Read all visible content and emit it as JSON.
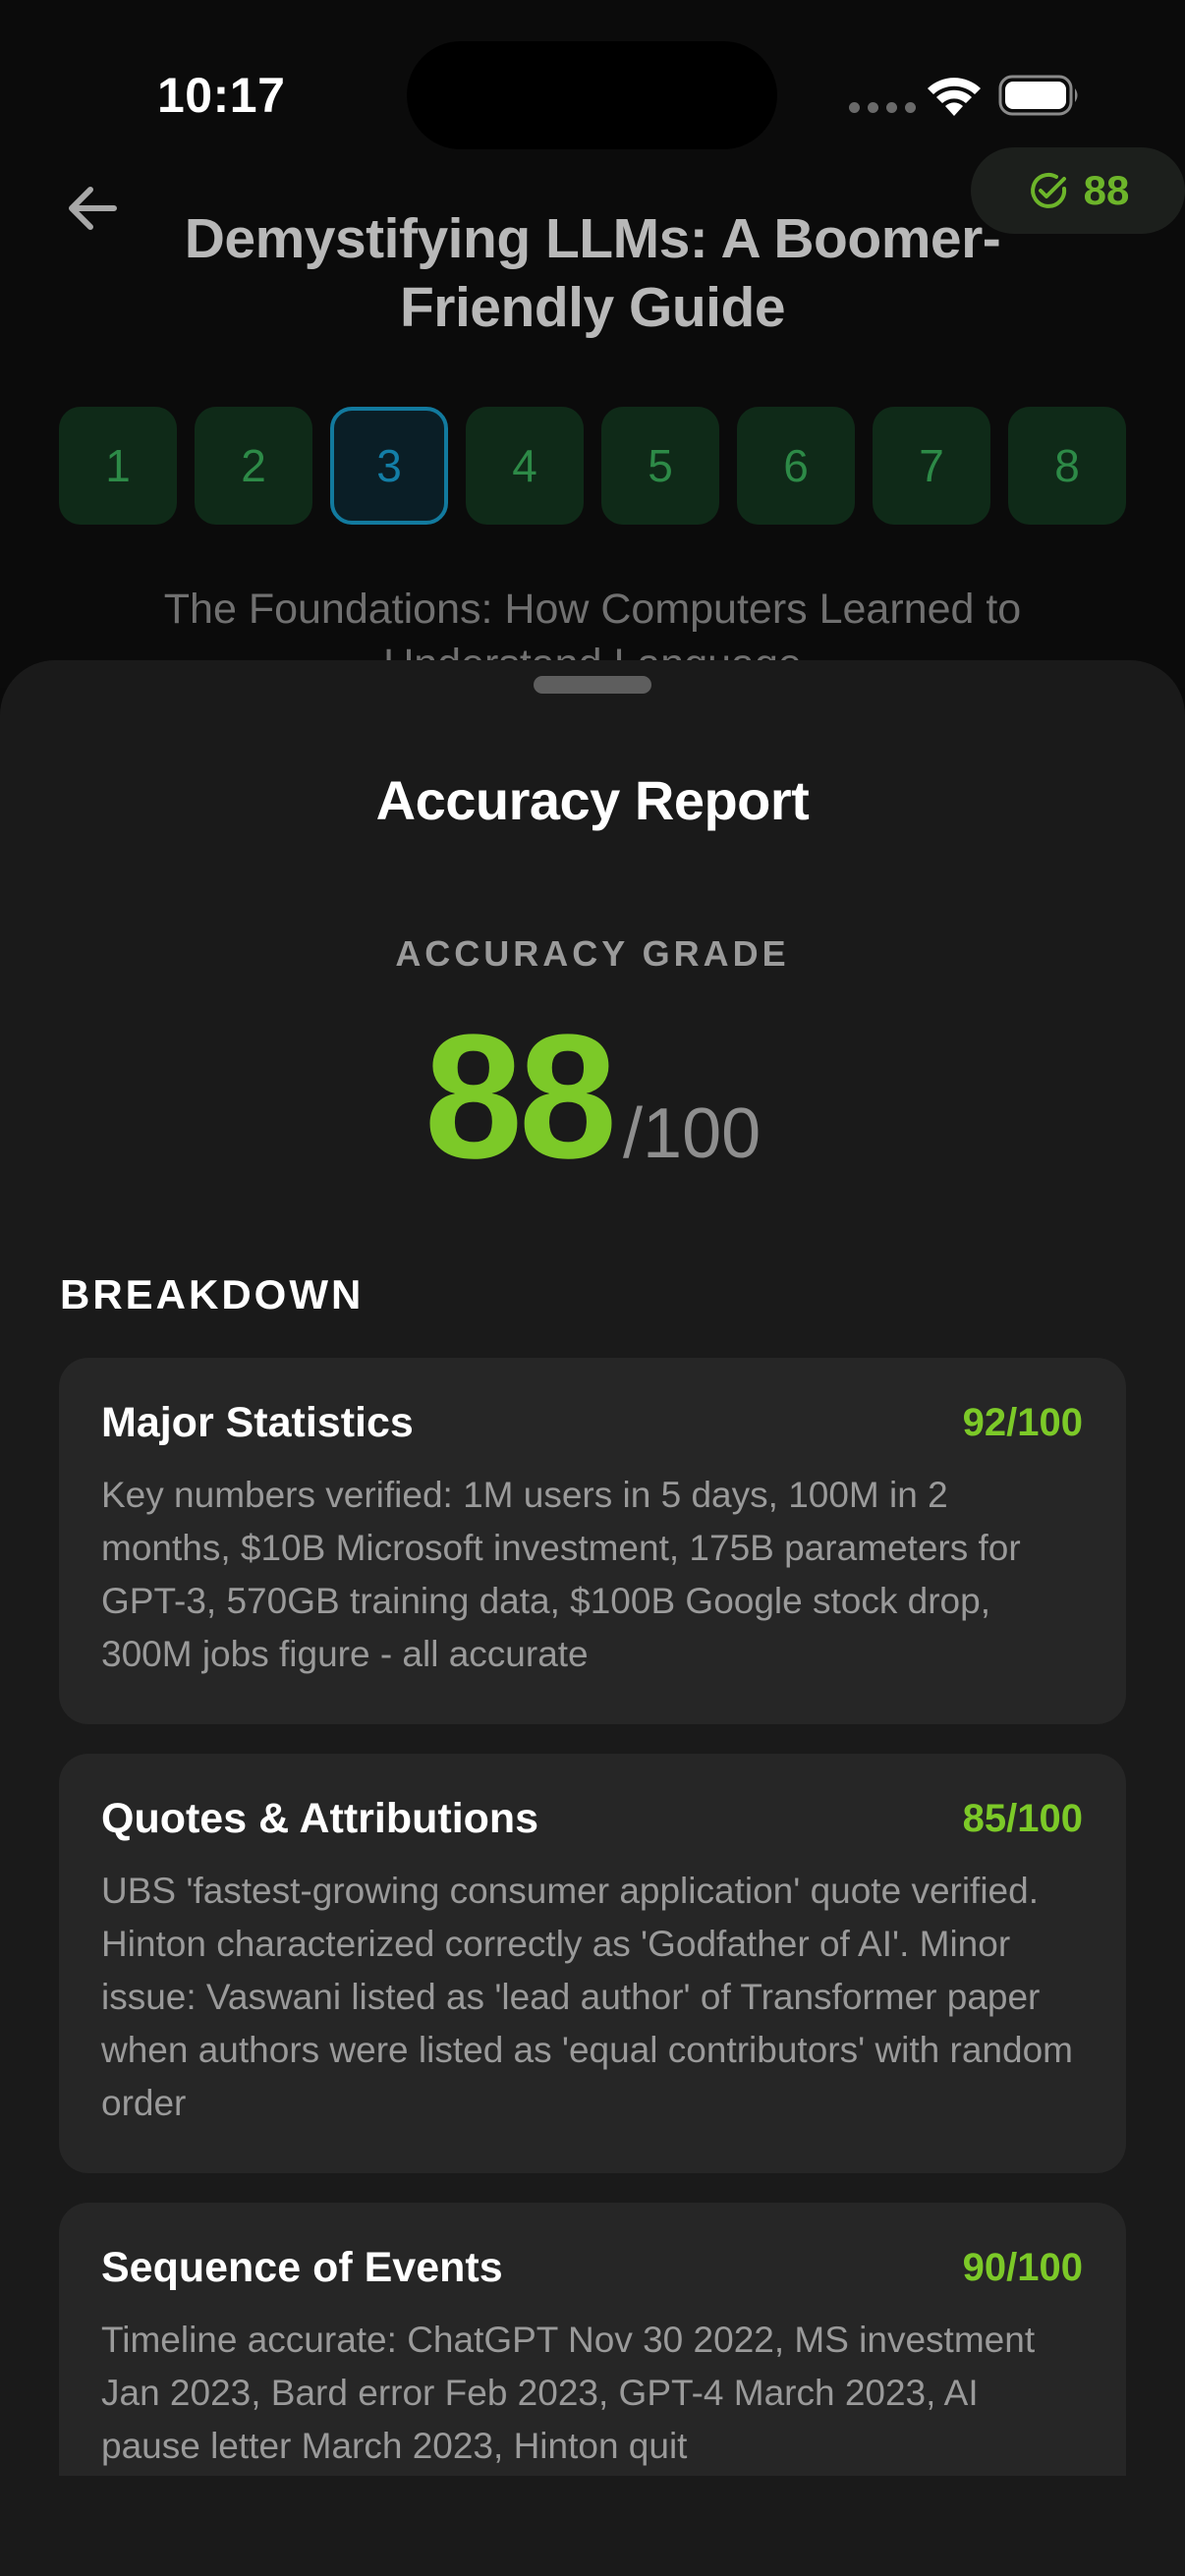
{
  "status_bar": {
    "time": "10:17"
  },
  "header": {
    "title": "Demystifying LLMs: A Boomer-Friendly Guide",
    "score_badge": "88"
  },
  "chapters": {
    "items": [
      "1",
      "2",
      "3",
      "4",
      "5",
      "6",
      "7",
      "8"
    ],
    "active_index": 2,
    "subtitle": "The Foundations: How Computers Learned to Understand Language"
  },
  "report": {
    "title": "Accuracy Report",
    "grade_label": "ACCURACY GRADE",
    "grade_value": "88",
    "grade_max": "/100",
    "breakdown_label": "BREAKDOWN",
    "cards": [
      {
        "title": "Major Statistics",
        "score": "92/100",
        "description": "Key numbers verified: 1M users in 5 days, 100M in 2 months, $10B Microsoft investment, 175B parameters for GPT-3, 570GB training data, $100B Google stock drop, 300M jobs figure - all accurate"
      },
      {
        "title": "Quotes & Attributions",
        "score": "85/100",
        "description": "UBS 'fastest-growing consumer application' quote verified. Hinton characterized correctly as 'Godfather of AI'. Minor issue: Vaswani listed as 'lead author' of Transformer paper when authors were listed as 'equal contributors' with random order"
      },
      {
        "title": "Sequence of Events",
        "score": "90/100",
        "description": "Timeline accurate: ChatGPT Nov 30 2022, MS investment Jan 2023, Bard error Feb 2023, GPT-4 March 2023, AI pause letter March 2023, Hinton quit"
      }
    ]
  },
  "colors": {
    "accent_green": "#7cc928",
    "active_tab_blue": "#127a9e",
    "tab_green": "#2d8a47"
  }
}
